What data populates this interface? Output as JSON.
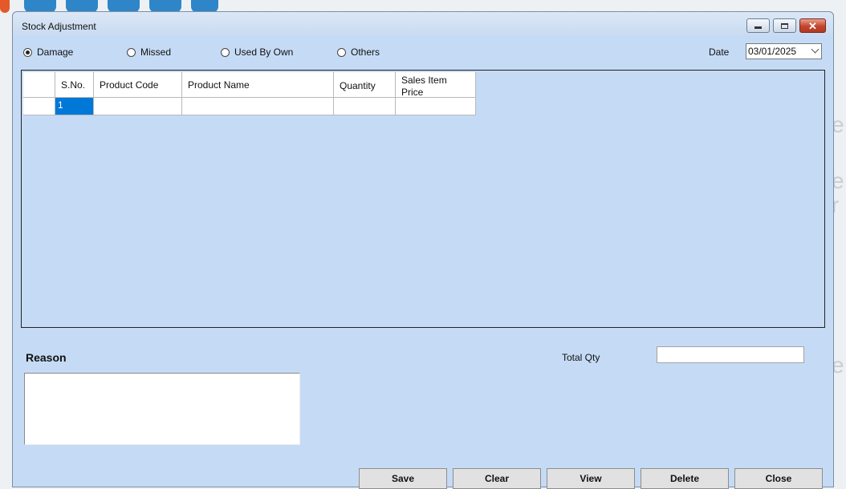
{
  "window": {
    "title": "Stock Adjustment",
    "controls": {
      "minimize": "minimize-icon",
      "maximize": "maximize-icon",
      "close": "close-icon"
    }
  },
  "adjustment_type": {
    "options": [
      "Damage",
      "Missed",
      "Used By Own",
      "Others"
    ],
    "selected": "Damage"
  },
  "date": {
    "label": "Date",
    "value": "03/01/2025"
  },
  "grid": {
    "columns": [
      "S.No.",
      "Product Code",
      "Product Name",
      "Quantity",
      "Sales Item Price"
    ],
    "rows": [
      {
        "sno": "1",
        "product_code": "",
        "product_name": "",
        "quantity": "",
        "sales_item_price": ""
      }
    ]
  },
  "reason": {
    "label": "Reason",
    "value": ""
  },
  "total_qty": {
    "label": "Total Qty",
    "value": ""
  },
  "buttons": {
    "save": "Save",
    "clear": "Clear",
    "view": "View",
    "delete": "Delete",
    "close": "Close"
  },
  "colors": {
    "form_background": "#c5dbf5",
    "selected_cell": "#0078d7"
  }
}
